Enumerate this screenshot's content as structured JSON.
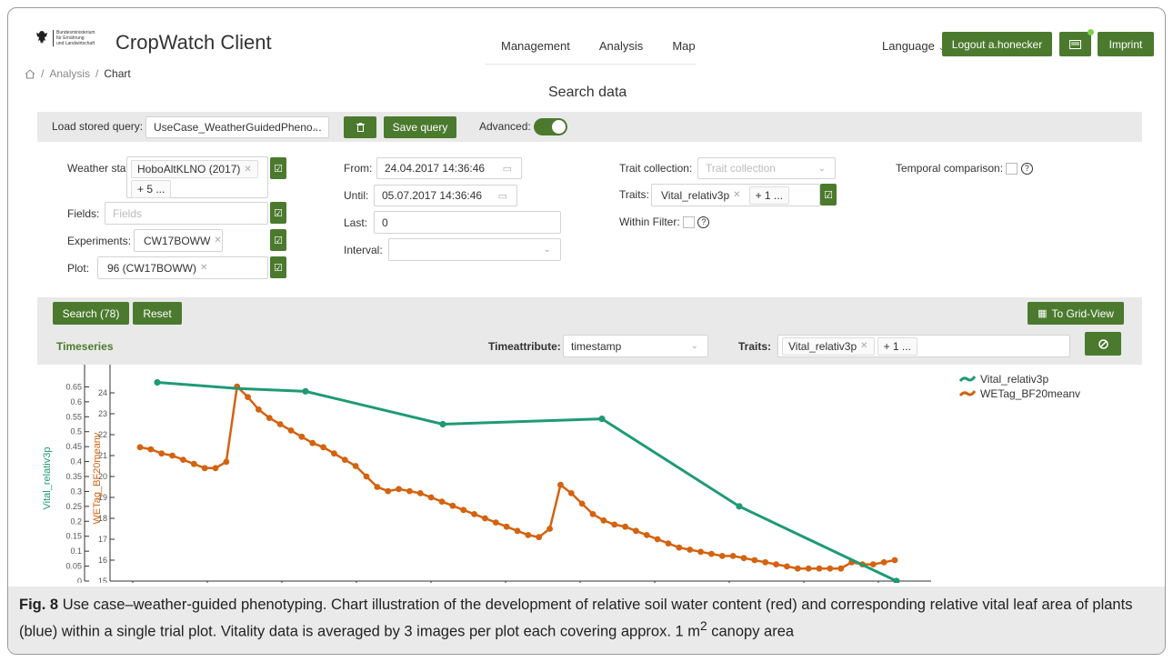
{
  "header": {
    "ministry_lines": [
      "Bundesministerium",
      "für Ernährung",
      "und Landwirtschaft"
    ],
    "app_title": "CropWatch Client",
    "nav": [
      "Management",
      "Analysis",
      "Map"
    ],
    "language_label": "Language",
    "logout_label": "Logout a.honecker",
    "imprint_label": "Imprint"
  },
  "breadcrumb": {
    "items": [
      "Analysis",
      "Chart"
    ],
    "separator": "/"
  },
  "page_title": "Search data",
  "query_bar": {
    "load_label": "Load stored query",
    "load_value": "UseCase_WeatherGuidedPheno...",
    "save_label": "Save query",
    "advanced_label": "Advanced",
    "advanced_on": true
  },
  "filters": {
    "weather_label": "Weather stat",
    "weather_tags": [
      "HoboAltKLNO (2017)"
    ],
    "weather_more": "+ 5 ...",
    "fields_label": "Fields",
    "fields_placeholder": "Fields",
    "experiments_label": "Experiments",
    "experiments_tags": [
      "CW17BOWW"
    ],
    "plot_label": "Plot",
    "plot_tags": [
      "96 (CW17BOWW)"
    ],
    "from_label": "From",
    "from_value": "24.04.2017 14:36:46",
    "until_label": "Until",
    "until_value": "05.07.2017 14:36:46",
    "last_label": "Last",
    "last_value": "0",
    "interval_label": "Interval",
    "trait_collection_label": "Trait collection",
    "trait_collection_placeholder": "Trait collection",
    "traits_label": "Traits",
    "traits_tags": [
      "Vital_relativ3p"
    ],
    "traits_more": "+ 1 ...",
    "within_filter_label": "Within Filter",
    "temporal_label": "Temporal comparison"
  },
  "results_bar": {
    "search_label": "Search (78)",
    "reset_label": "Reset",
    "grid_view_label": "To Grid-View",
    "section_title": "Timeseries",
    "timeattribute_label": "Timeattribute",
    "timeattribute_value": "timestamp",
    "traits_label": "Traits",
    "traits_tags": [
      "Vital_relativ3p"
    ],
    "traits_more": "+ 1 ..."
  },
  "colors": {
    "green_button": "#4b7a2e",
    "series_teal": "#1f9a74",
    "series_orange": "#d4620f"
  },
  "chart_data": {
    "type": "line",
    "y1label": "Vital_relativ3p",
    "y2label": "WETag_BF20meanv",
    "y1ticks": [
      "0.65",
      "0.6",
      "0.55",
      "0.5",
      "0.45",
      "0.4",
      "0.35",
      "0.3",
      "0.25",
      "0.2",
      "0.15",
      "0.1",
      "0.05",
      "0"
    ],
    "y1lim": [
      0,
      0.7
    ],
    "y2ticks": [
      "24",
      "23",
      "22",
      "21",
      "20",
      "19",
      "18",
      "17",
      "16",
      "15"
    ],
    "y2lim": [
      15,
      25
    ],
    "x_count": 55,
    "legend_position": "top-right",
    "series": [
      {
        "name": "Vital_relativ3p",
        "axis": "left",
        "points": [
          [
            1,
            0.665
          ],
          [
            16,
            0.635
          ],
          [
            27,
            0.626
          ],
          [
            53,
            0.0
          ]
        ],
        "display_points": [
          [
            1,
            0.665
          ],
          [
            13,
            0.645
          ],
          [
            16,
            0.635
          ],
          [
            22,
            0.525
          ],
          [
            40,
            0.543
          ],
          [
            48,
            0.25
          ],
          [
            60,
            0.0
          ]
        ]
      },
      {
        "name": "WETag_BF20meanv",
        "axis": "right",
        "values": [
          21.4,
          21.3,
          21.1,
          21.0,
          20.8,
          20.6,
          20.4,
          20.4,
          20.7,
          24.3,
          23.8,
          23.2,
          22.8,
          22.5,
          22.2,
          21.9,
          21.6,
          21.4,
          21.1,
          20.8,
          20.5,
          20.0,
          19.5,
          19.3,
          19.4,
          19.3,
          19.2,
          19.0,
          18.8,
          18.6,
          18.4,
          18.2,
          18.0,
          17.8,
          17.6,
          17.4,
          17.2,
          17.1,
          17.5,
          19.6,
          19.2,
          18.7,
          18.2,
          17.9,
          17.7,
          17.6,
          17.4,
          17.2,
          17.0,
          16.8,
          16.6,
          16.5,
          16.4,
          16.3,
          16.2,
          16.2,
          16.1,
          16.0,
          15.9,
          15.8,
          15.7,
          15.6,
          15.6,
          15.6,
          15.6,
          15.6,
          15.9,
          15.8,
          15.8,
          15.9,
          16.0
        ]
      }
    ]
  },
  "caption": {
    "label": "Fig. 8",
    "text_part1": "Use case–weather-guided phenotyping. Chart illustration of the development of relative soil water content (red) and corresponding relative vital leaf area of plants (blue) within a single trial plot. Vitality data is averaged by 3 images per plot each covering approx. 1 m",
    "superscript": "2",
    "text_part2": " canopy area"
  }
}
